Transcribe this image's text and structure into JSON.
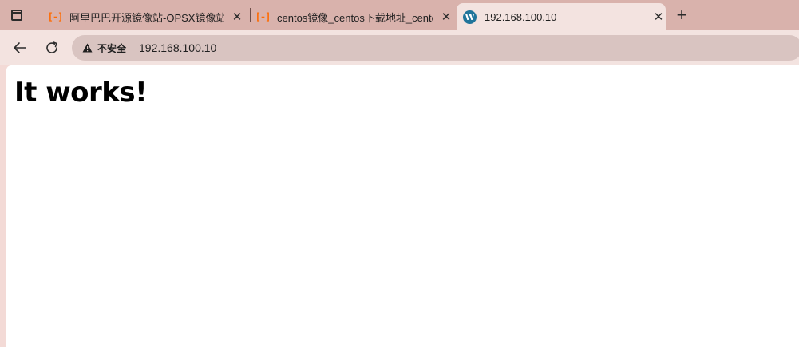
{
  "browser": {
    "tabs": [
      {
        "title": "阿里巴巴开源镜像站-OPSX镜像站",
        "favicon": "aliyun-bracket-icon",
        "close_label": "✕",
        "active": false
      },
      {
        "title": "centos镜像_centos下载地址_centos",
        "favicon": "aliyun-bracket-icon",
        "close_label": "✕",
        "active": false
      },
      {
        "title": "192.168.100.10",
        "favicon": "wordpress-icon",
        "close_label": "✕",
        "active": true
      }
    ],
    "new_tab_label": "+",
    "favicon_glyph": "[-]",
    "wp_glyph": "W"
  },
  "toolbar": {
    "security_label": "不安全",
    "url": "192.168.100.10"
  },
  "page": {
    "heading": "It works!"
  },
  "colors": {
    "tab_strip": "#d9b2ac",
    "active_tab": "#f3e3e0",
    "omnibox": "#d9c4c1",
    "aliyun_orange": "#ff6a00",
    "wordpress_blue": "#21759b"
  }
}
